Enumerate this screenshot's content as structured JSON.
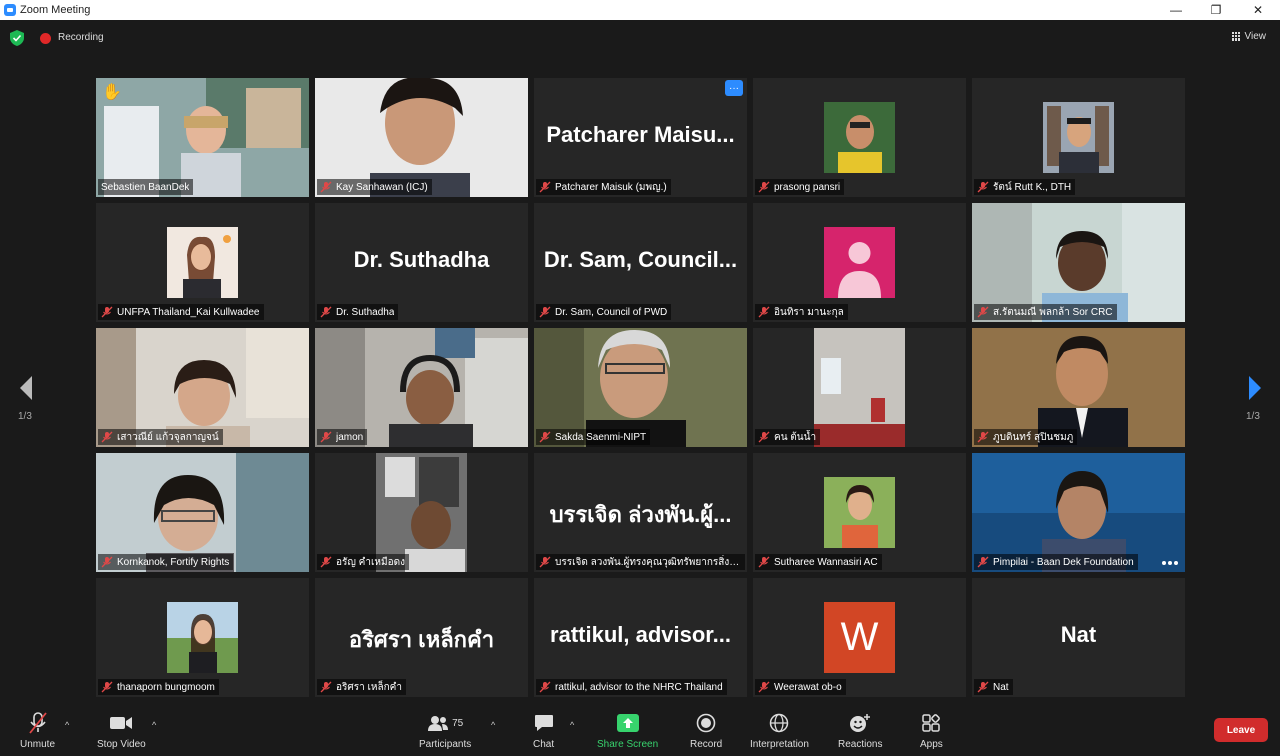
{
  "window": {
    "title": "Zoom Meeting",
    "minimize": "—",
    "maximize": "❐",
    "close": "✕"
  },
  "topbar": {
    "recording_label": "Recording",
    "view_label": "View"
  },
  "nav": {
    "left_page": "1/3",
    "right_page": "1/3"
  },
  "participants": [
    {
      "name": "Sebastien BaanDek",
      "display": "",
      "muted": false,
      "hand_raised": true
    },
    {
      "name": "Kay Sanhawan (ICJ)",
      "display": "",
      "muted": true
    },
    {
      "name": "Patcharer Maisuk (มพญ.)",
      "display": "Patcharer  Maisu...",
      "muted": true
    },
    {
      "name": "prasong pansri",
      "display": "",
      "muted": true
    },
    {
      "name": "รัตน์ Rutt K., DTH",
      "display": "",
      "muted": true
    },
    {
      "name": "UNFPA Thailand_Kai Kullwadee",
      "display": "",
      "muted": true
    },
    {
      "name": "Dr. Suthadha",
      "display": "Dr. Suthadha",
      "muted": true
    },
    {
      "name": "Dr. Sam, Council of PWD",
      "display": "Dr. Sam,  Council...",
      "muted": true
    },
    {
      "name": "อินทิรา  มานะกุล",
      "display": "",
      "muted": true
    },
    {
      "name": "ส.รัตนมณี พลกล้า Sor CRC",
      "display": "",
      "muted": true
    },
    {
      "name": "เสาวณีย์  แก้วจุลกาญจน์",
      "display": "",
      "muted": true
    },
    {
      "name": "jamon",
      "display": "",
      "muted": true
    },
    {
      "name": "Sakda Saenmi-NIPT",
      "display": "",
      "muted": true
    },
    {
      "name": "คน ต้นน้ำ",
      "display": "",
      "muted": true
    },
    {
      "name": "ภูบดินทร์ สุปินชมภู",
      "display": "",
      "muted": true
    },
    {
      "name": "Kornkanok, Fortify Rights",
      "display": "",
      "muted": true
    },
    {
      "name": "อรัญ คำเหมือดง",
      "display": "",
      "muted": true
    },
    {
      "name": "บรรเจิด ลวงพัน.ผู้ทรงคุณวุฒิทรัพยากรสิ่งแวดล้...",
      "display": "บรรเจิด ล่วงพัน.ผู้...",
      "muted": true
    },
    {
      "name": "Sutharee Wannasiri AC",
      "display": "",
      "muted": true
    },
    {
      "name": "Pimpilai - Baan Dek Foundation",
      "display": "",
      "muted": true
    },
    {
      "name": "thanaporn bungmoom",
      "display": "",
      "muted": true
    },
    {
      "name": "อริศรา เหล็กคำ",
      "display": "อริศรา เหล็กคำ",
      "muted": true
    },
    {
      "name": "rattikul, advisor to the NHRC Thailand",
      "display": "rattikul,  advisor...",
      "muted": true
    },
    {
      "name": "Weerawat ob-o",
      "display": "",
      "muted": true,
      "avatar_letter": "W"
    },
    {
      "name": "Nat",
      "display": "Nat",
      "muted": true
    }
  ],
  "toolbar": {
    "unmute": "Unmute",
    "stop_video": "Stop Video",
    "participants": "Participants",
    "participant_count": "75",
    "chat": "Chat",
    "share_screen": "Share Screen",
    "record": "Record",
    "interpretation": "Interpretation",
    "reactions": "Reactions",
    "apps": "Apps",
    "leave": "Leave"
  },
  "colors": {
    "active_speaker_border": "#e8e37a",
    "share_green": "#37d36d",
    "leave_red": "#d12c2c",
    "accent_blue": "#2d8cff"
  }
}
